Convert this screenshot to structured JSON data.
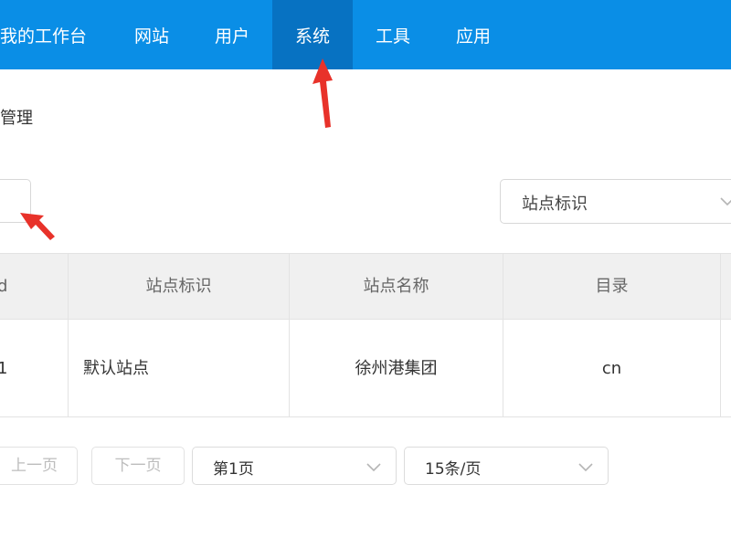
{
  "nav": {
    "items": [
      {
        "label": "我的工作台"
      },
      {
        "label": "网站"
      },
      {
        "label": "用户"
      },
      {
        "label": "系统",
        "active": true
      },
      {
        "label": "工具"
      },
      {
        "label": "应用"
      }
    ],
    "background_color": "#0a8ee6",
    "active_color": "#0772c2"
  },
  "page": {
    "title": "管理"
  },
  "filter": {
    "select_label": "站点标识",
    "select_icon": "chevron-down-icon"
  },
  "table": {
    "headers": [
      "d",
      "站点标识",
      "站点名称",
      "目录"
    ],
    "rows": [
      [
        "1",
        "默认站点",
        "徐州港集团",
        "cn"
      ]
    ]
  },
  "pagination": {
    "prev_label": "上一页",
    "next_label": "下一页",
    "page_select": "第1页",
    "size_select": "15条/页"
  },
  "annotations": {
    "arrow_color": "#e8322a"
  }
}
